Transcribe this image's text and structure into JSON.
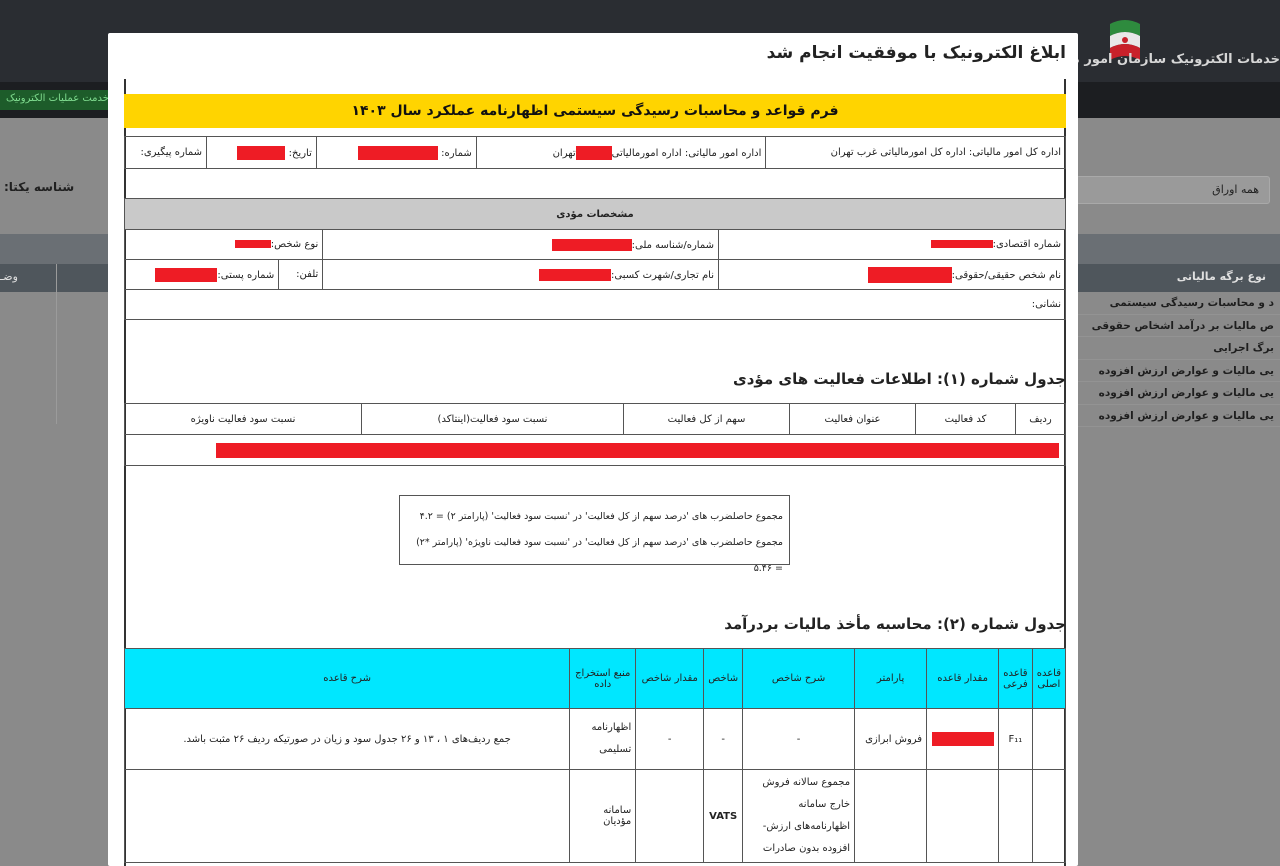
{
  "background": {
    "app_title": "خدمات الکترونیک سازمان امور مالیاتی",
    "nav_badge": "میز خدمت عملیات الکترونیک",
    "unique_id_label": "شناسه یکتا:",
    "select_value": "همه اوراق",
    "column_header": "نوع برگه مالیاتی",
    "left_header": "وضـ",
    "rows": [
      "د و محاسبات رسیدگی سیستمی",
      "ص مالیات بر درآمد اشخاص حقوقی",
      "برگ اجرایی",
      "یی مالیات و عوارض ارزش افزوده",
      "یی مالیات و عوارض ارزش افزوده",
      "یی مالیات و عوارض ارزش افزوده"
    ]
  },
  "modal": {
    "title": "ابلاغ الکترونیک با موفقیت انجام شد",
    "form_title": "فرم قواعد و محاسبات رسیدگی سیستمی اظهارنامه عملکرد سال ۱۴۰۳",
    "info": {
      "general_office": "اداره کل امور مالیاتی: اداره کل امورمالیاتی غرب تهران",
      "office": "اداره امور مالیاتی: اداره امورمالیاتی",
      "office_city": "تهران",
      "number_label": "شماره:",
      "date_label": "تاریخ:",
      "tracking_label": "شماره پیگیری:"
    },
    "payer": {
      "header": "مشخصات مؤدی",
      "economic_code": "شماره اقتصادی:",
      "national_id": "شماره/شناسه ملی:",
      "person_type": "نوع شخص:",
      "name": "نام شخص حقیقی/حقوقی:",
      "trade_name": "نام تجاری/شهرت کسبی:",
      "phone": "تلفن:",
      "postal_code": "شماره پستی:",
      "address": "نشانی:"
    },
    "table1": {
      "heading": "جدول شماره (۱): اطلاعات فعالیت های مؤدی",
      "columns": [
        "ردیف",
        "کد فعالیت",
        "عنوان فعالیت",
        "سهم از کل فعالیت",
        "نسبت سود فعالیت(اینتاکد)",
        "نسبت سود فعالیت ناویژه"
      ]
    },
    "formula": {
      "line1": "مجموع حاصلضرب های 'درصد سهم از کل فعالیت' در 'نسبت سود فعالیت' (پارامتر ۲) = ۴.۲",
      "line2": "مجموع حاصلضرب های 'درصد سهم از کل فعالیت' در 'نسبت سود فعالیت ناویژه' (پارامتر *۲) = ۵.۴۶"
    },
    "table2": {
      "heading": "جدول شماره (۲): محاسبه مأخذ مالیات بردرآمد",
      "columns": [
        "قاعده اصلی",
        "قاعده فرعی",
        "مقدار قاعده",
        "پارامتر",
        "شرح شاخص",
        "شاخص",
        "مقدار شاخص",
        "منبع استخراج داده",
        "شرح قاعده"
      ],
      "rows": [
        {
          "main_rule": "",
          "sub_rule": "F₁₁",
          "parameter": "فروش ابرازی",
          "index_desc": "-",
          "index": "-",
          "index_value": "-",
          "source": "اظهارنامه تسلیمی",
          "rule_desc": "جمع ردیف‌های ۱ ، ۱۳ و ۲۶ جدول سود و زیان در صورتیکه ردیف ۲۶ مثبت باشد."
        },
        {
          "main_rule": "",
          "sub_rule": "",
          "parameter": "",
          "index_desc": "مجموع سالانه فروش خارج سامانه اظهارنامه‌های ارزش-افزوده بدون صادرات",
          "index": "VATS",
          "index_value": "",
          "source": "سامانه مؤدیان",
          "rule_desc": ""
        }
      ]
    }
  }
}
